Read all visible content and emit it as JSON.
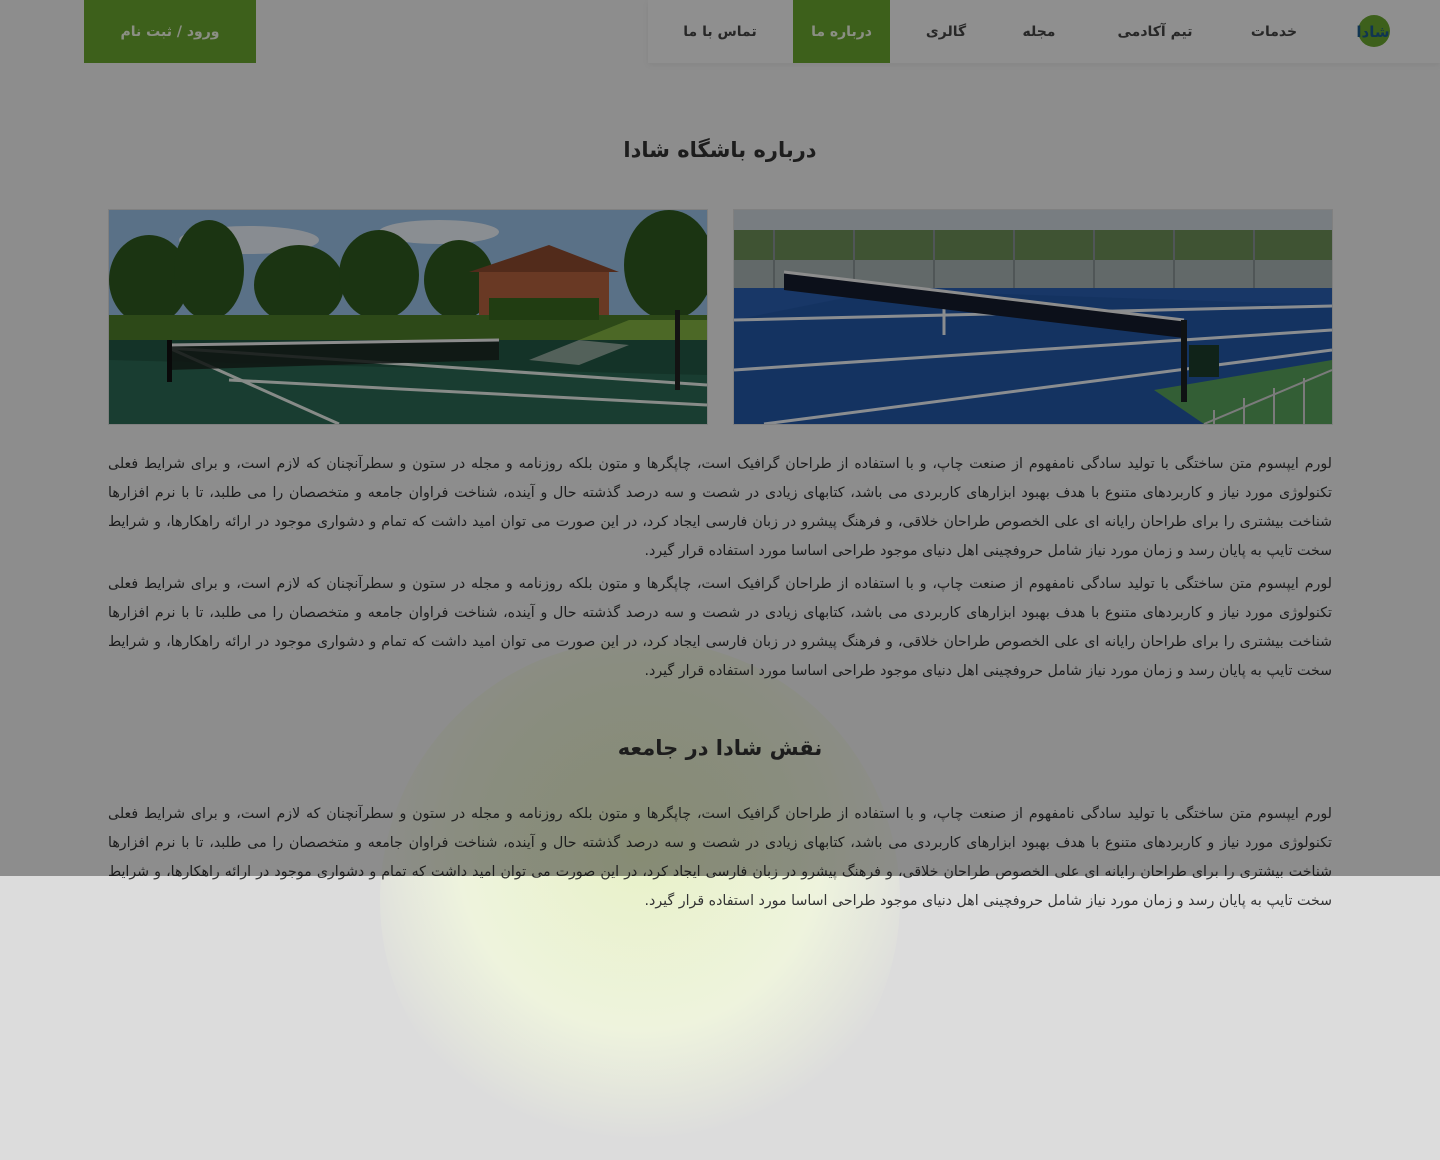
{
  "header": {
    "logo_text": "شادا",
    "nav": [
      {
        "label": "خدمات",
        "active": false
      },
      {
        "label": "تیم آکادمی",
        "active": false
      },
      {
        "label": "مجله",
        "active": false
      },
      {
        "label": "گالری",
        "active": false
      },
      {
        "label": "درباره ما",
        "active": true
      },
      {
        "label": "تماس با ما",
        "active": false
      }
    ],
    "login_label": "ورود / ثبت نام"
  },
  "about": {
    "title": "درباره باشگاه شادا",
    "paragraphs": [
      "لورم ایپسوم متن ساختگی با تولید سادگی نامفهوم از صنعت چاپ، و با استفاده از طراحان گرافیک است، چاپگرها و متون بلکه روزنامه و مجله در ستون و سطرآنچنان که لازم است، و برای شرایط فعلی تکنولوژی مورد نیاز و کاربردهای متنوع با هدف بهبود ابزارهای کاربردی می باشد، کتابهای زیادی در شصت و سه درصد گذشته حال و آینده، شناخت فراوان جامعه و متخصصان را می طلبد، تا با نرم افزارها شناخت بیشتری را برای طراحان رایانه ای علی الخصوص طراحان خلاقی، و فرهنگ پیشرو در زبان فارسی ایجاد کرد، در این صورت می توان امید داشت که تمام و دشواری موجود در ارائه راهکارها، و شرایط سخت تایپ به پایان رسد و زمان مورد نیاز شامل حروفچینی اهل دنیای موجود طراحی اساسا مورد استفاده قرار گیرد.",
      "لورم ایپسوم متن ساختگی با تولید سادگی نامفهوم از صنعت چاپ، و با استفاده از طراحان گرافیک است، چاپگرها و متون بلکه روزنامه و مجله در ستون و سطرآنچنان که لازم است، و برای شرایط فعلی تکنولوژی مورد نیاز و کاربردهای متنوع با هدف بهبود ابزارهای کاربردی می باشد، کتابهای زیادی در شصت و سه درصد گذشته حال و آینده، شناخت فراوان جامعه و متخصصان را می طلبد، تا با نرم افزارها شناخت بیشتری را برای طراحان رایانه ای علی الخصوص طراحان خلاقی، و فرهنگ پیشرو در زبان فارسی ایجاد کرد، در این صورت می توان امید داشت که تمام و دشواری موجود در ارائه راهکارها، و شرایط سخت تایپ به پایان رسد و زمان مورد نیاز شامل حروفچینی اهل دنیای موجود طراحی اساسا مورد استفاده قرار گیرد."
    ]
  },
  "role": {
    "title": "نقش شادا در جامعه",
    "paragraph": "لورم ایپسوم متن ساختگی با تولید سادگی نامفهوم از صنعت چاپ، و با استفاده از طراحان گرافیک است، چاپگرها و متون بلکه روزنامه و مجله در ستون و سطرآنچنان که لازم است، و برای شرایط فعلی تکنولوژی مورد نیاز و کاربردهای متنوع با هدف بهبود ابزارهای کاربردی می باشد، کتابهای زیادی در شصت و سه درصد گذشته حال و آینده، شناخت فراوان جامعه و متخصصان را می طلبد، تا با نرم افزارها شناخت بیشتری را برای طراحان رایانه ای علی الخصوص طراحان خلاقی، و فرهنگ پیشرو در زبان فارسی ایجاد کرد، در این صورت می توان امید داشت که تمام و دشواری موجود در ارائه راهکارها، و شرایط سخت تایپ به پایان رسد و زمان مورد نیاز شامل حروفچینی اهل دنیای موجود طراحی اساسا مورد استفاده قرار گیرد."
  },
  "colors": {
    "accent": "#6aa52f",
    "background": "#f3f3f3",
    "overlay": "rgba(0,0,0,0.42)"
  }
}
